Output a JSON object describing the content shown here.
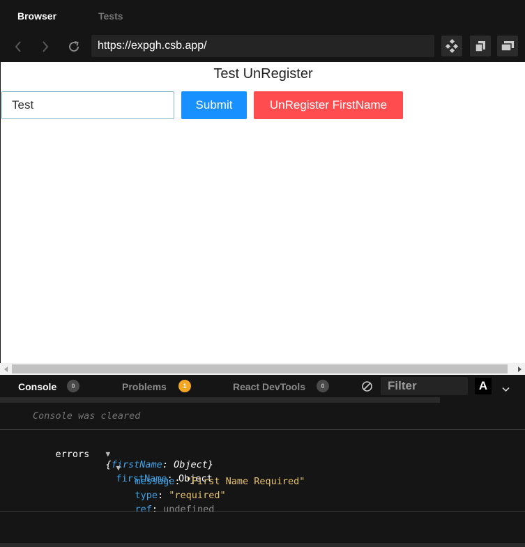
{
  "tabs": {
    "browser": "Browser",
    "tests": "Tests"
  },
  "address": {
    "url": "https://expgh.csb.app/"
  },
  "preview": {
    "title": "Test UnRegister",
    "input_value": "Test",
    "submit_label": "Submit",
    "unregister_label": "UnRegister FirstName"
  },
  "devtools": {
    "console_tab": "Console",
    "console_count": "0",
    "problems_tab": "Problems",
    "problems_count": "1",
    "react_tab": "React DevTools",
    "react_count": "0",
    "filter_placeholder": "Filter",
    "font_toggle": "A"
  },
  "console": {
    "cleared": "Console was cleared",
    "log_label": "errors",
    "obj_open": "{",
    "obj_key": "firstName",
    "obj_sep": ": ",
    "obj_type": "Object",
    "obj_close": "}",
    "child_key": "firstName",
    "child_sep": ": ",
    "child_type": "Object",
    "message_key": "message",
    "message_value": "\"First Name Required\"",
    "type_key": "type",
    "type_value": "\"required\"",
    "ref_key": "ref",
    "ref_value": "undefined",
    "colon": ": "
  },
  "colors": {
    "submit": "#1890ff",
    "unregister": "#ff4d4f",
    "problems_badge": "#f5a623"
  }
}
